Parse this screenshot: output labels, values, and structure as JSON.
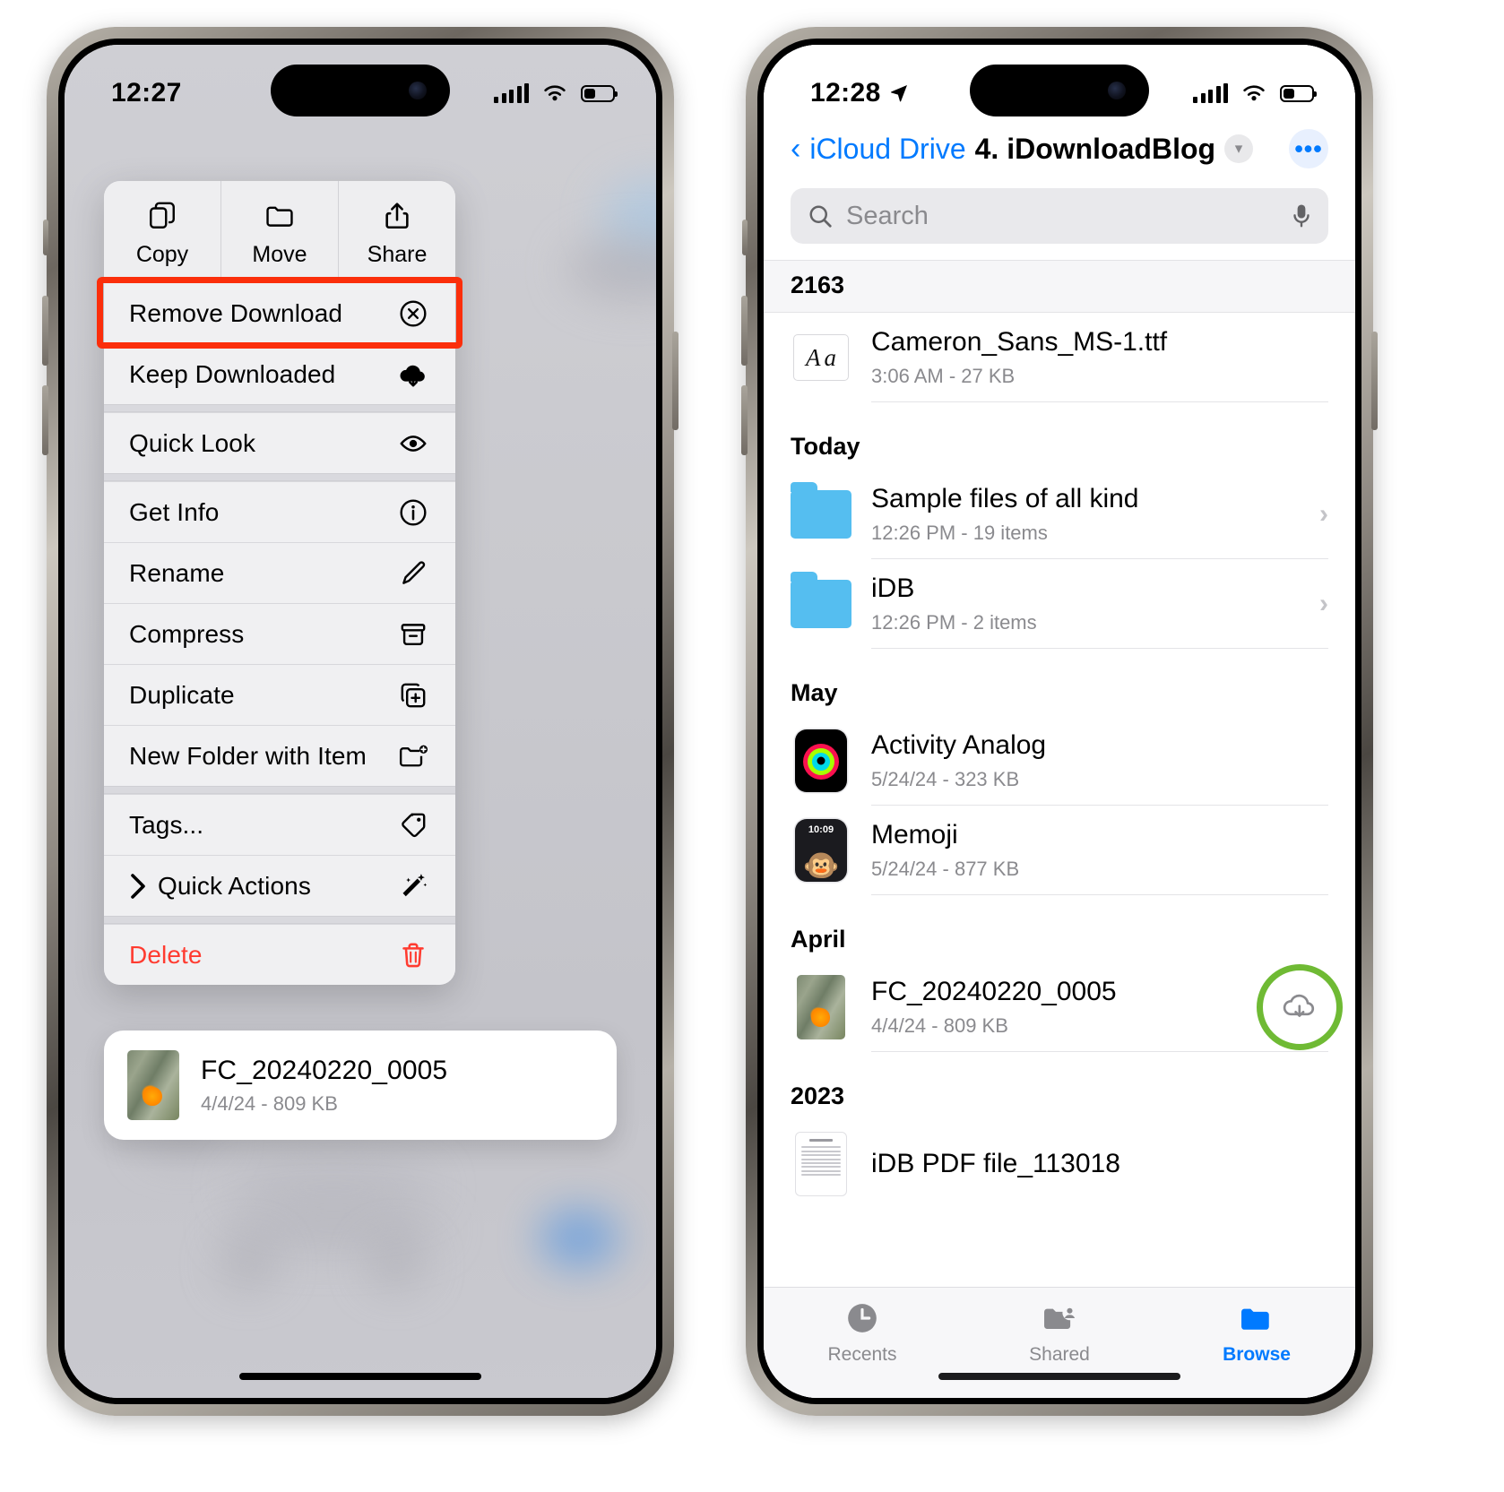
{
  "left_phone": {
    "status_bar": {
      "time": "12:27",
      "signal": "cellular-bars",
      "wifi": "wifi-icon",
      "battery": "battery-icon"
    },
    "context_menu": {
      "top_actions": [
        {
          "label": "Copy",
          "icon": "copy-icon"
        },
        {
          "label": "Move",
          "icon": "folder-icon"
        },
        {
          "label": "Share",
          "icon": "share-icon"
        }
      ],
      "items": [
        {
          "label": "Remove Download",
          "icon": "remove-download-icon",
          "highlighted": true,
          "destructive": false,
          "submenu": false
        },
        {
          "label": "Keep Downloaded",
          "icon": "cloud-download-icon",
          "highlighted": false,
          "destructive": false,
          "submenu": false
        },
        {
          "label": "Quick Look",
          "icon": "eye-icon",
          "highlighted": false,
          "destructive": false,
          "submenu": false
        },
        {
          "label": "Get Info",
          "icon": "info-circle-icon",
          "highlighted": false,
          "destructive": false,
          "submenu": false
        },
        {
          "label": "Rename",
          "icon": "pencil-icon",
          "highlighted": false,
          "destructive": false,
          "submenu": false
        },
        {
          "label": "Compress",
          "icon": "archive-box-icon",
          "highlighted": false,
          "destructive": false,
          "submenu": false
        },
        {
          "label": "Duplicate",
          "icon": "duplicate-icon",
          "highlighted": false,
          "destructive": false,
          "submenu": false
        },
        {
          "label": "New Folder with Item",
          "icon": "folder-plus-icon",
          "highlighted": false,
          "destructive": false,
          "submenu": false
        },
        {
          "label": "Tags...",
          "icon": "tag-icon",
          "highlighted": false,
          "destructive": false,
          "submenu": false
        },
        {
          "label": "Quick Actions",
          "icon": "wand-sparkles-icon",
          "highlighted": false,
          "destructive": false,
          "submenu": true
        },
        {
          "label": "Delete",
          "icon": "trash-icon",
          "highlighted": false,
          "destructive": true,
          "submenu": false
        }
      ],
      "highlight_color": "#fb2e0b",
      "destructive_color": "#ff3b30"
    },
    "selected_file": {
      "name": "FC_20240220_0005",
      "meta": "4/4/24 - 809 KB",
      "thumbnail": "photo-thumbnail"
    }
  },
  "right_phone": {
    "status_bar": {
      "time": "12:28",
      "location_arrow": "location-arrow-icon",
      "signal": "cellular-bars",
      "wifi": "wifi-icon",
      "battery": "battery-icon"
    },
    "nav": {
      "back_icon": "chevron-left-icon",
      "parent": "iCloud Drive",
      "title": "4. iDownloadBlog",
      "title_chevron": "chevron-down-icon",
      "more_icon": "ellipsis-circle-icon",
      "accent": "#007aff"
    },
    "search": {
      "placeholder": "Search",
      "icon": "search-icon",
      "mic_icon": "microphone-icon"
    },
    "sections": [
      {
        "header": "2163",
        "style": "grouped",
        "rows": [
          {
            "name": "Cameron_Sans_MS-1.ttf",
            "meta": "3:06 AM - 27 KB",
            "icon": "font-file-icon",
            "chevron": false,
            "download_badge": false
          }
        ]
      },
      {
        "header": "Today",
        "style": "plain",
        "rows": [
          {
            "name": "Sample files of all kind",
            "meta": "12:26 PM - 19 items",
            "icon": "folder-icon",
            "chevron": true,
            "download_badge": false
          },
          {
            "name": "iDB",
            "meta": "12:26 PM - 2 items",
            "icon": "folder-icon",
            "chevron": true,
            "download_badge": false
          }
        ]
      },
      {
        "header": "May",
        "style": "plain",
        "rows": [
          {
            "name": "Activity Analog",
            "meta": "5/24/24 - 323 KB",
            "icon": "watch-face-icon",
            "chevron": false,
            "download_badge": false
          },
          {
            "name": "Memoji",
            "meta": "5/24/24 - 877 KB",
            "icon": "memoji-watch-icon",
            "chevron": false,
            "download_badge": false
          }
        ]
      },
      {
        "header": "April",
        "style": "plain",
        "rows": [
          {
            "name": "FC_20240220_0005",
            "meta": "4/4/24 - 809 KB",
            "icon": "photo-thumbnail",
            "chevron": false,
            "download_badge": true
          }
        ]
      },
      {
        "header": "2023",
        "style": "plain",
        "rows": [
          {
            "name": "iDB PDF file_113018",
            "meta": "",
            "icon": "pdf-file-icon",
            "chevron": false,
            "download_badge": false
          }
        ]
      }
    ],
    "download_badge": {
      "icon": "cloud-download-icon",
      "ring_color": "#6fba34"
    },
    "tabbar": [
      {
        "label": "Recents",
        "icon": "clock-icon",
        "active": false
      },
      {
        "label": "Shared",
        "icon": "shared-folder-icon",
        "active": false
      },
      {
        "label": "Browse",
        "icon": "folder-icon",
        "active": true
      }
    ]
  }
}
